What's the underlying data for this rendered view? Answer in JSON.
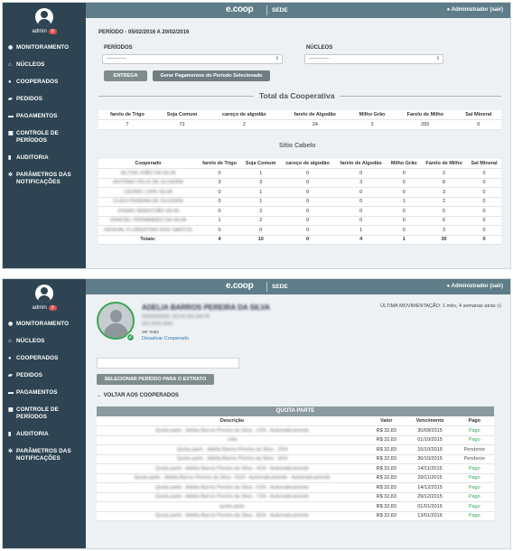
{
  "app": {
    "logo": "e.coop",
    "sede": "SEDE",
    "admin_label": "Administrador (sair)"
  },
  "sidebar": {
    "user_name": "admin",
    "user_badge": "0",
    "items": [
      {
        "icon": "globe-icon",
        "label": "MONITORAMENTO"
      },
      {
        "icon": "home-icon",
        "label": "NÚCLEOS"
      },
      {
        "icon": "user-icon",
        "label": "COOPERADOS"
      },
      {
        "icon": "cart-icon",
        "label": "PEDIDOS"
      },
      {
        "icon": "money-icon",
        "label": "PAGAMENTOS"
      },
      {
        "icon": "calendar-icon",
        "label": "CONTROLE DE PERÍODOS"
      },
      {
        "icon": "chart-icon",
        "label": "AUDITORIA"
      },
      {
        "icon": "gear-icon",
        "label": "PARÂMETROS DAS NOTIFICAÇÕES"
      }
    ]
  },
  "screen1": {
    "periodo": "PERÍODO - 05/02/2016 A 20/02/2016",
    "periodos_label": "PERÍODOS",
    "periodos_value": "-----------",
    "nucleos_label": "NÚCLEOS",
    "nucleos_value": "-----------",
    "entrega_button": "ENTREGA",
    "gerar_button": "Gerar Pagamentos do Período Selecionado",
    "total_title": "Total da Cooperativa",
    "total_table": {
      "headers": [
        "farelo de Trigo",
        "Soja Comum",
        "caroço de algodão",
        "farelo de Algodão",
        "Milho Grão",
        "Farelo de Milho",
        "Sal Mineral"
      ],
      "values": [
        "7",
        "72",
        "2",
        "24",
        "3",
        "265",
        "0"
      ]
    },
    "sitio_title": "Sítio Cabelo",
    "sitio_table": {
      "headers": [
        "Cooperado",
        "farelo de Trigo",
        "Soja Comum",
        "caroço de algodão",
        "farelo de Algodão",
        "Milho Grão",
        "Farelo de Milho",
        "Sal Mineral"
      ],
      "rows": [
        [
          "AILTON JOÃO DA SILVA",
          "0",
          "1",
          "0",
          "0",
          "0",
          "2",
          "0"
        ],
        [
          "ANTÔNIO FÉLIX DE OLIVEIRA",
          "3",
          "3",
          "0",
          "3",
          "0",
          "8",
          "0"
        ],
        [
          "CEDRIC LOPE SILVA",
          "0",
          "1",
          "0",
          "0",
          "0",
          "3",
          "0"
        ],
        [
          "CLEDI PEREIRA DE OLIVEIRA",
          "0",
          "1",
          "0",
          "0",
          "1",
          "2",
          "0"
        ],
        [
          "JOSIAS SEBASTIÃO SILVA",
          "0",
          "2",
          "0",
          "0",
          "0",
          "5",
          "0"
        ],
        [
          "GRACIEL FERNANDES DA SILVA",
          "1",
          "2",
          "0",
          "0",
          "0",
          "6",
          "0"
        ],
        [
          "GENIVAL FLORENTINO DOS SANTOS",
          "0",
          "0",
          "0",
          "1",
          "0",
          "3",
          "0"
        ]
      ],
      "totals": [
        "Totais:",
        "4",
        "10",
        "0",
        "4",
        "1",
        "30",
        "0"
      ]
    }
  },
  "screen2": {
    "coop_name": "ADELIA BARROS PEREIRA DA SILVA",
    "coop_line1": "00000000000, SÍLVIO BELÉM PE",
    "coop_line2": "(00) 0000-0000",
    "ver_mais": "ver mais",
    "desativar": "Desativar Cooperado",
    "ultima": "ÚLTIMA MOVIMENTAÇÃO: 1 mês, 4 semanas atrás",
    "selecionar_button": "SELECIONAR PERÍODO PARA O EXTRATO",
    "voltar": "VOLTAR AOS COOPERADOS",
    "quota_title": "QUOTA PARTE",
    "quota_headers": [
      "Descrição",
      "Valor",
      "Vencimento",
      "Pago"
    ],
    "quota_rows": [
      {
        "desc": "Quota parte - Adelia Barros Pereira da Silva - 1/24 - Automaticamente",
        "valor": "R$ 32,83",
        "venc": "30/09/2015",
        "pago": "Pago"
      },
      {
        "desc": "cota",
        "valor": "R$ 32,83",
        "venc": "01/10/2015",
        "pago": "Pago"
      },
      {
        "desc": "Quota parte - Adelia Barros Pereira da Silva - 2/24",
        "valor": "R$ 32,83",
        "venc": "15/10/2015",
        "pago": "Pendente"
      },
      {
        "desc": "Quota parte - Adelia Barros Pereira da Silva - 3/24",
        "valor": "R$ 32,83",
        "venc": "30/10/2015",
        "pago": "Pendente"
      },
      {
        "desc": "Quota parte - Adelia Barros Pereira da Silva - 4/24 - Automaticamente",
        "valor": "R$ 32,83",
        "venc": "14/11/2015",
        "pago": "Pago"
      },
      {
        "desc": "Quota parte - Adelia Barros Pereira da Silva - 5/24 - Automaticamente - Automaticamente",
        "valor": "R$ 32,83",
        "venc": "29/11/2015",
        "pago": "Pago"
      },
      {
        "desc": "Quota parte - Adelia Barros Pereira da Silva - 6/24 - Automaticamente",
        "valor": "R$ 32,83",
        "venc": "14/12/2015",
        "pago": "Pago"
      },
      {
        "desc": "Quota parte - Adelia Barros Pereira da Silva - 7/24 - Automaticamente",
        "valor": "R$ 32,83",
        "venc": "29/12/2015",
        "pago": "Pago"
      },
      {
        "desc": "quota parte",
        "valor": "R$ 32,83",
        "venc": "01/01/2016",
        "pago": "Pago"
      },
      {
        "desc": "Quota parte - Adelia Barros Pereira da Silva - 8/24 - Automaticamente",
        "valor": "R$ 32,83",
        "venc": "13/01/2016",
        "pago": "Pago"
      }
    ]
  },
  "colors": {
    "sidebar": "#2e4453",
    "topbar": "#5e7d89",
    "pago": "#3ba55d",
    "badge": "#d9534f"
  }
}
